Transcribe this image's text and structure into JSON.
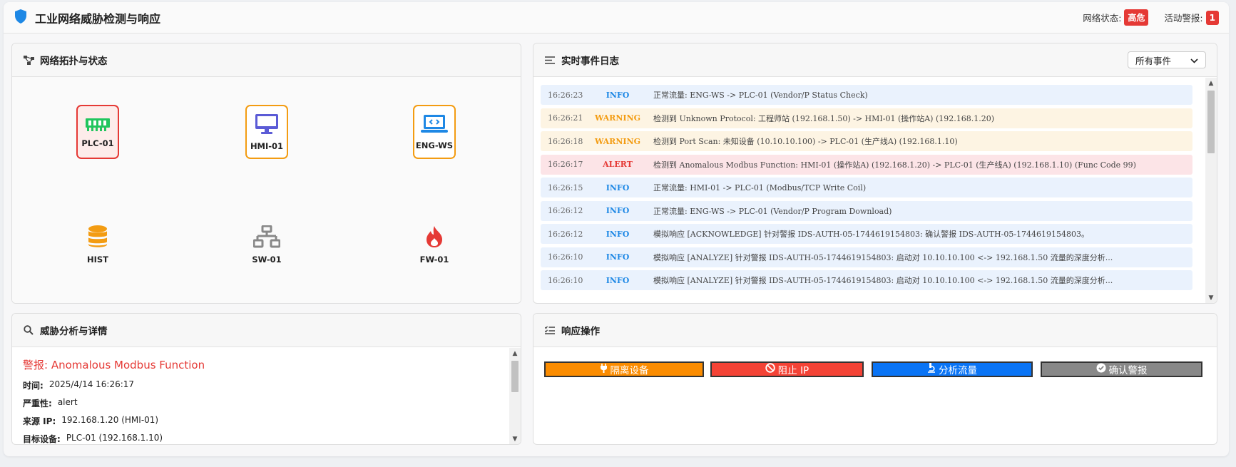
{
  "header": {
    "title": "工业网络威胁检测与响应",
    "network_status_label": "网络状态:",
    "network_status_value": "高危",
    "active_alerts_label": "活动警报:",
    "active_alerts_value": "1"
  },
  "topology": {
    "title": "网络拓扑与状态",
    "nodes": [
      {
        "label": "PLC-01",
        "icon": "ram-chip-icon",
        "color": "#22c55e",
        "status_color": "#e53935"
      },
      {
        "label": "HMI-01",
        "icon": "monitor-icon",
        "color": "#5b5bd6",
        "status_color": "#f39c12"
      },
      {
        "label": "ENG-WS",
        "icon": "laptop-code-icon",
        "color": "#1e88e5",
        "status_color": "#f39c12"
      },
      {
        "label": "HIST",
        "icon": "database-icon",
        "color": "#f39c12"
      },
      {
        "label": "SW-01",
        "icon": "network-switch-icon",
        "color": "#888888"
      },
      {
        "label": "FW-01",
        "icon": "fire-icon",
        "color": "#e53935"
      }
    ]
  },
  "events": {
    "title": "实时事件日志",
    "filter": "所有事件",
    "rows": [
      {
        "time": "16:26:23",
        "level": "INFO",
        "msg": "正常流量: ENG-WS -> PLC-01 (Vendor/P Status Check)"
      },
      {
        "time": "16:26:21",
        "level": "WARNING",
        "msg": "检测到 Unknown Protocol: 工程师站 (192.168.1.50) -> HMI-01 (操作站A) (192.168.1.20)"
      },
      {
        "time": "16:26:18",
        "level": "WARNING",
        "msg": "检测到 Port Scan: 未知设备 (10.10.10.100) -> PLC-01 (生产线A) (192.168.1.10)"
      },
      {
        "time": "16:26:17",
        "level": "ALERT",
        "msg": "检测到 Anomalous Modbus Function: HMI-01 (操作站A) (192.168.1.20) -> PLC-01 (生产线A) (192.168.1.10) (Func Code 99)"
      },
      {
        "time": "16:26:15",
        "level": "INFO",
        "msg": "正常流量: HMI-01 -> PLC-01 (Modbus/TCP Write Coil)"
      },
      {
        "time": "16:26:12",
        "level": "INFO",
        "msg": "正常流量: ENG-WS -> PLC-01 (Vendor/P Program Download)"
      },
      {
        "time": "16:26:12",
        "level": "INFO",
        "msg": "模拟响应 [ACKNOWLEDGE] 针对警报 IDS-AUTH-05-1744619154803: 确认警报 IDS-AUTH-05-1744619154803。"
      },
      {
        "time": "16:26:10",
        "level": "INFO",
        "msg": "模拟响应 [ANALYZE] 针对警报 IDS-AUTH-05-1744619154803: 启动对 10.10.10.100 <-> 192.168.1.50 流量的深度分析..."
      },
      {
        "time": "16:26:10",
        "level": "INFO",
        "msg": "模拟响应 [ANALYZE] 针对警报 IDS-AUTH-05-1744619154803: 启动对 10.10.10.100 <-> 192.168.1.50 流量的深度分析..."
      }
    ]
  },
  "analysis": {
    "title": "威胁分析与详情",
    "alert_prefix": "警报:",
    "alert_name": "Anomalous Modbus Function",
    "time_label": "时间:",
    "time_value": "2025/4/14 16:26:17",
    "severity_label": "严重性:",
    "severity_value": "alert",
    "source_label": "来源 IP:",
    "source_value": "192.168.1.20 (HMI-01)",
    "target_label": "目标设备:",
    "target_value": "PLC-01 (192.168.1.10)"
  },
  "actions": {
    "title": "响应操作",
    "isolate": "隔离设备",
    "block": "阻止 IP",
    "analyze": "分析流量",
    "acknowledge": "确认警报",
    "colors": {
      "isolate": "#fb8c00",
      "block": "#f44336",
      "analyze": "#0a74f5",
      "acknowledge": "#888888"
    }
  }
}
